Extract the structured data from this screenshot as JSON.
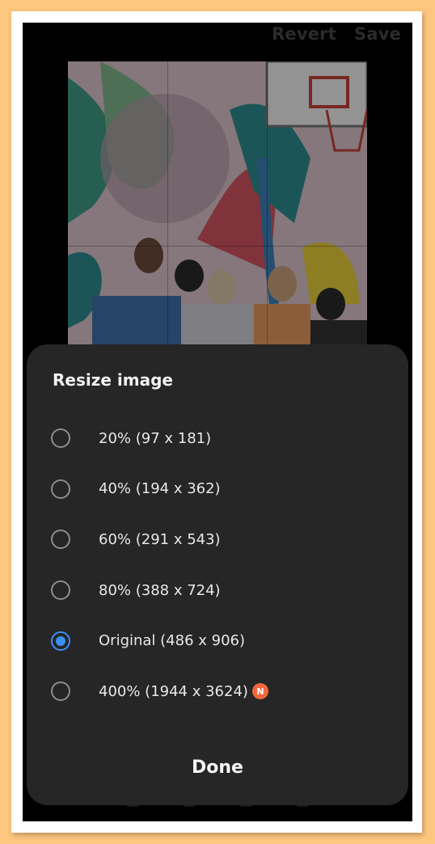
{
  "topbar": {
    "revert_label": "Revert",
    "save_label": "Save"
  },
  "dialog": {
    "title": "Resize image",
    "options": [
      {
        "label": "20% (97 x 181)",
        "selected": false,
        "badge": ""
      },
      {
        "label": "40% (194 x 362)",
        "selected": false,
        "badge": ""
      },
      {
        "label": "60% (291 x 543)",
        "selected": false,
        "badge": ""
      },
      {
        "label": "80% (388 x 724)",
        "selected": false,
        "badge": ""
      },
      {
        "label": "Original (486 x 906)",
        "selected": true,
        "badge": ""
      },
      {
        "label": "400% (1944 x 3624)",
        "selected": false,
        "badge": "N"
      }
    ],
    "done_label": "Done"
  },
  "colors": {
    "accent": "#3c8ef5",
    "badge": "#f2683c",
    "sheet": "#262626",
    "background": "#fdc77e"
  }
}
